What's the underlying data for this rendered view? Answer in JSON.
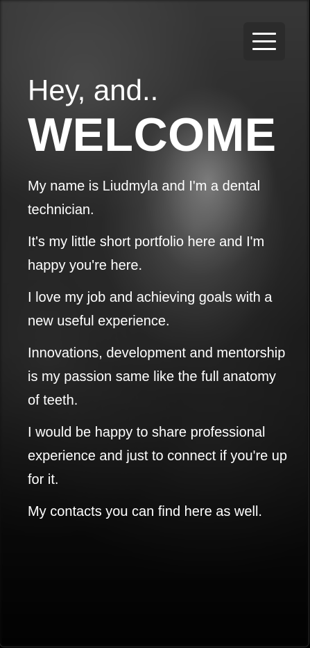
{
  "header": {
    "menu_icon": "hamburger-menu-icon"
  },
  "hero": {
    "greeting": "Hey, and..",
    "title": "WELCOME"
  },
  "intro": {
    "paragraphs": [
      "My name is Liudmyla and I'm a dental technician.",
      "It's my little short portfolio here and I'm happy you're here.",
      "I love my job and achieving goals with a new useful experience.",
      "Innovations, development and mentorship is my passion same like the full anatomy of teeth.",
      "I would be happy to share professional experience and just to connect if you're up for it.",
      "My contacts you can find here as well."
    ]
  }
}
